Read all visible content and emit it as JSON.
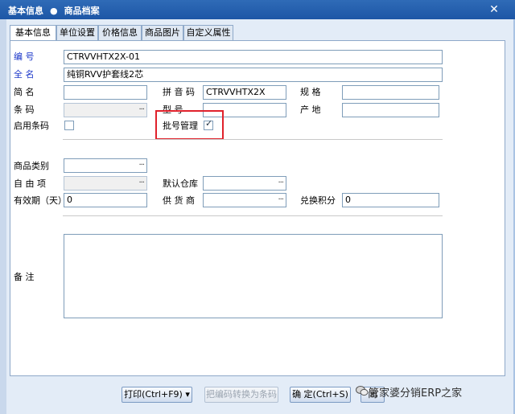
{
  "window": {
    "breadcrumb_1": "基本信息",
    "breadcrumb_sep": "●",
    "breadcrumb_2": "商品档案",
    "close_glyph": "✕"
  },
  "tabs": [
    {
      "label": "基本信息",
      "active": true
    },
    {
      "label": "单位设置"
    },
    {
      "label": "价格信息"
    },
    {
      "label": "商品图片"
    },
    {
      "label": "自定义属性"
    }
  ],
  "form": {
    "code_label": "编    号",
    "code_value": "CTRVVHTX2X-01",
    "fullname_label": "全    名",
    "fullname_value": "纯铜RVV护套线2芯",
    "shortname_label": "简    名",
    "shortname_value": "",
    "pinyin_label": "拼 音 码",
    "pinyin_value": "CTRVVHTX2X",
    "spec_label": "规    格",
    "spec_value": "",
    "barcode_label": "条    码",
    "barcode_dots": "···",
    "model_label": "型    号",
    "model_value": "",
    "origin_label": "产    地",
    "origin_value": "",
    "enable_barcode_label": "启用条码",
    "batch_label": "批号管理",
    "category_label": "商品类别",
    "category_dots": "···",
    "free_item_label": "自 由 项",
    "free_item_dots": "···",
    "default_wh_label": "默认仓库",
    "default_wh_dots": "···",
    "expiry_label": "有效期（天）",
    "expiry_value": "0",
    "supplier_label": "供 货 商",
    "supplier_dots": "···",
    "points_label": "兑换积分",
    "points_value": "0",
    "remark_label": "备    注"
  },
  "checkboxes": {
    "enable_barcode_checked": false,
    "batch_checked": true
  },
  "buttons": {
    "print": "打印(Ctrl+F9)",
    "print_arrow": "▾",
    "convert": "把编码转换为条码",
    "ok": "确  定(Ctrl+S)",
    "close_partial": "闭"
  },
  "watermark": "管家婆分销ERP之家",
  "colors": {
    "titlebar": "#1d56a6",
    "label_blue": "#1a36c9",
    "highlight_red": "#e0212b"
  }
}
